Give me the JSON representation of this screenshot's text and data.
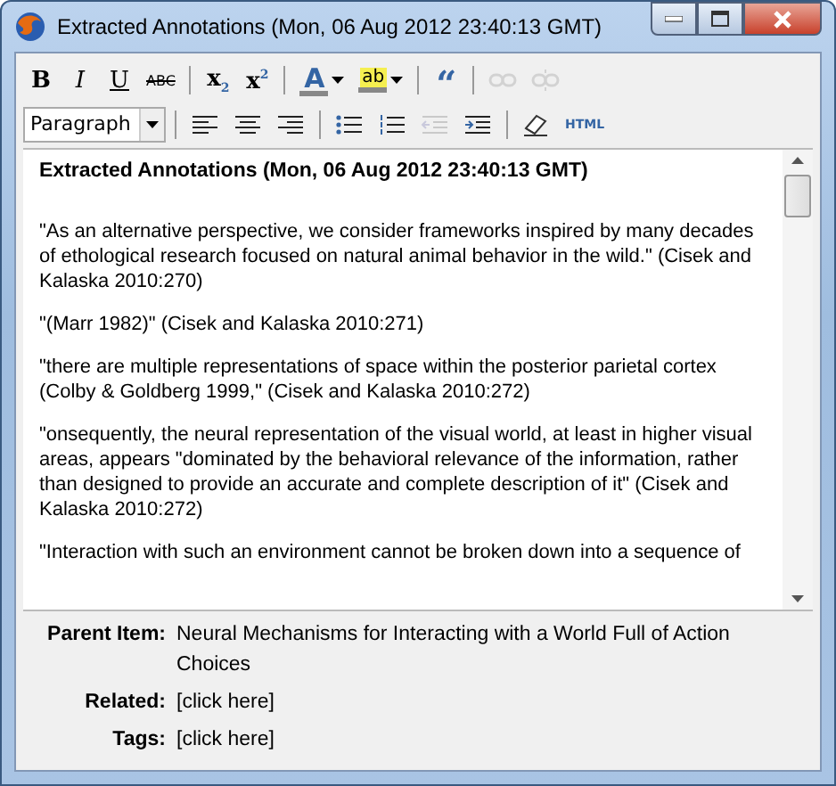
{
  "window": {
    "title": "Extracted Annotations (Mon, 06 Aug 2012 23:40:13 GMT)"
  },
  "toolbar_rows": [
    [
      {
        "kind": "bold",
        "label": "B",
        "disabled": false
      },
      {
        "kind": "italic",
        "label": "I",
        "disabled": false
      },
      {
        "kind": "underline",
        "label": "U",
        "disabled": false
      },
      {
        "kind": "strike",
        "label": "ABC",
        "disabled": false
      },
      {
        "kind": "sep"
      },
      {
        "kind": "subscript",
        "label": "x",
        "mark": "2",
        "disabled": false
      },
      {
        "kind": "superscript",
        "label": "x",
        "mark": "2",
        "disabled": false
      },
      {
        "kind": "sep"
      },
      {
        "kind": "textcolor",
        "label": "A",
        "disabled": false
      },
      {
        "kind": "highlight",
        "label": "ab",
        "disabled": false
      },
      {
        "kind": "sep"
      },
      {
        "kind": "quote",
        "label": "“",
        "disabled": false
      },
      {
        "kind": "sep"
      },
      {
        "kind": "link",
        "disabled": true
      },
      {
        "kind": "unlink",
        "disabled": true
      }
    ],
    [
      {
        "kind": "format",
        "label": "Paragraph"
      },
      {
        "kind": "sep"
      },
      {
        "kind": "alignleft",
        "disabled": false
      },
      {
        "kind": "aligncenter",
        "disabled": false
      },
      {
        "kind": "alignright",
        "disabled": false
      },
      {
        "kind": "sep"
      },
      {
        "kind": "bullets",
        "disabled": false
      },
      {
        "kind": "numbers",
        "disabled": false
      },
      {
        "kind": "outdent",
        "disabled": true
      },
      {
        "kind": "indent",
        "disabled": false
      },
      {
        "kind": "sep"
      },
      {
        "kind": "eraser",
        "disabled": false
      },
      {
        "kind": "html",
        "label": "HTML",
        "disabled": false
      }
    ]
  ],
  "editor": {
    "heading": "Extracted Annotations (Mon, 06 Aug 2012 23:40:13 GMT)",
    "paragraphs": [
      "\"As an alternative perspective, we consider frameworks inspired by many decades of ethological research focused on natural animal behavior in the wild.\" (Cisek and Kalaska 2010:270)",
      "\"(Marr 1982)\" (Cisek and Kalaska 2010:271)",
      "\"there are multiple representations of space within the posterior parietal cortex (Colby & Goldberg 1999,\" (Cisek and Kalaska 2010:272)",
      "\"onsequently, the neural representation of the visual world, at least in higher visual areas, appears \"dominated by the behavioral relevance of the information, rather than designed to provide an accurate and complete description of it\" (Cisek and Kalaska 2010:272)",
      "\"Interaction with such an environment cannot be broken down into a sequence of"
    ]
  },
  "fields": [
    {
      "label": "Parent Item:",
      "value": "Neural Mechanisms for Interacting with a World Full of Action Choices"
    },
    {
      "label": "Related:",
      "value": "[click here]"
    },
    {
      "label": "Tags:",
      "value": "[click here]"
    }
  ]
}
